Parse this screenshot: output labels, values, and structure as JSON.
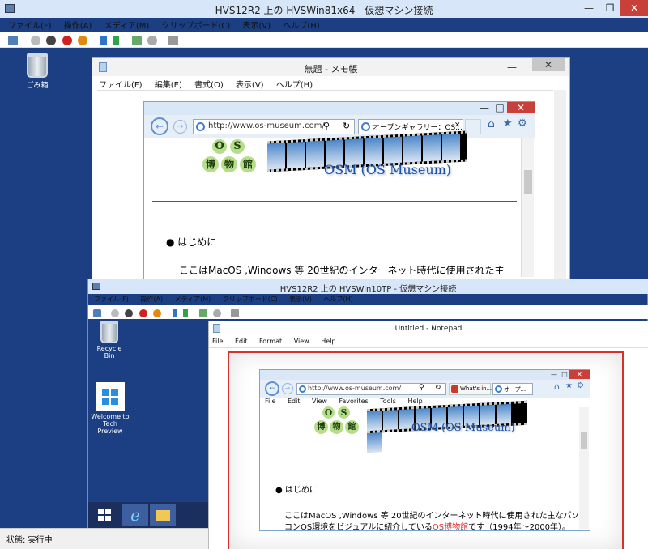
{
  "outer": {
    "title": "HVS12R2 上の HVSWin81x64 - 仮想マシン接続",
    "menu": [
      "ファイル(F)",
      "操作(A)",
      "メディア(M)",
      "クリップボード(C)",
      "表示(V)",
      "ヘルプ(H)"
    ],
    "desktop": {
      "recycle_label": "ごみ箱"
    }
  },
  "notepad1": {
    "title": "無題 - メモ帳",
    "menu": [
      "ファイル(F)",
      "編集(E)",
      "書式(O)",
      "表示(V)",
      "ヘルプ(H)"
    ]
  },
  "ie1": {
    "address": "http://www.os-museum.com/",
    "tab": "オープンギャラリー：OS...",
    "logo": {
      "char1": "O",
      "char2": "S",
      "char3": "博",
      "char4": "物",
      "char5": "館"
    },
    "site_title": "OSM (OS Museum)",
    "bullet": "はじめに",
    "paragraph": "ここはMacOS ,Windows 等 20世紀のインターネット時代に使用された主"
  },
  "inner": {
    "title": "HVS12R2 上の HVSWin10TP - 仮想マシン接続",
    "menu": [
      "ファイル(F)",
      "操作(A)",
      "メディア(M)",
      "クリップボード(C)",
      "表示(V)",
      "ヘルプ(H)"
    ],
    "desktop": {
      "recycle_label": "Recycle Bin",
      "welcome_line1": "Welcome to",
      "welcome_line2": "Tech Preview"
    },
    "status": "状態: 実行中"
  },
  "notepad2": {
    "title": "Untitled - Notepad",
    "menu": [
      "File",
      "Edit",
      "Format",
      "View",
      "Help"
    ]
  },
  "ie2": {
    "address": "http://www.os-museum.com/",
    "tab1": "What's in...",
    "tab2": "オープ...",
    "menu": [
      "File",
      "Edit",
      "View",
      "Favorites",
      "Tools",
      "Help"
    ],
    "bullet": "はじめに",
    "para_line1": "ここはMacOS ,Windows 等 20世紀のインターネット時代に使用された主なパソ",
    "para_line2_a": "コンOS環境をビジュアルに紹介している",
    "para_line2_link": "OS博物館",
    "para_line2_b": "です（1994年～2000年）。"
  },
  "colors": {
    "desktop_blue": "#1c3f84",
    "highlight_red": "#d9302c",
    "close_red": "#c7403a"
  }
}
